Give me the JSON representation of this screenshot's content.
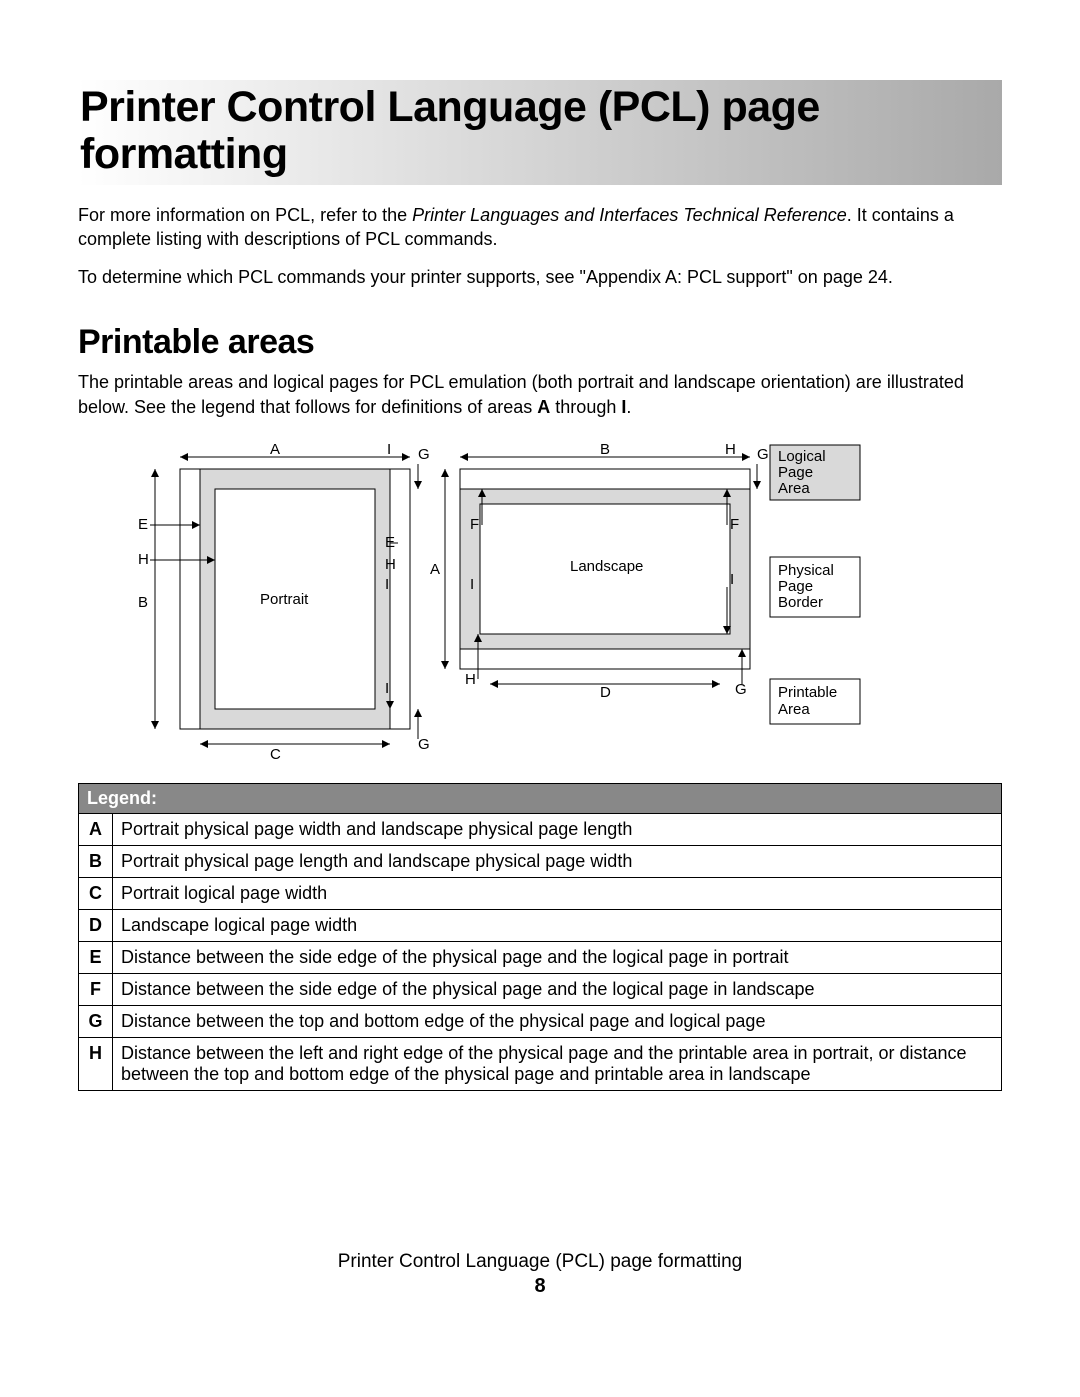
{
  "title": "Printer Control Language (PCL) page formatting",
  "intro1_a": "For more information on PCL, refer to the ",
  "intro1_em": "Printer Languages and Interfaces Technical Reference",
  "intro1_b": ". It contains a complete listing with descriptions of PCL commands.",
  "intro2": "To determine which PCL commands your printer supports, see \"Appendix A: PCL support\" on page 24.",
  "section_heading": "Printable areas",
  "section_para_a": "The printable areas and logical pages for PCL emulation (both portrait and landscape orientation) are illustrated below. See the legend that follows for definitions of areas ",
  "section_para_b1": "A",
  "section_para_mid": " through ",
  "section_para_b2": "I",
  "section_para_end": ".",
  "diagram": {
    "portrait_label": "Portrait",
    "landscape_label": "Landscape",
    "logical_page_area": "Logical Page Area",
    "physical_page_border": "Physical Page Border",
    "printable_area": "Printable Area",
    "A": "A",
    "B": "B",
    "C": "C",
    "D": "D",
    "E": "E",
    "F": "F",
    "G": "G",
    "H": "H",
    "I": "I"
  },
  "legend": {
    "header": "Legend:",
    "rows": [
      {
        "key": "A",
        "desc": "Portrait physical page width and landscape physical page length"
      },
      {
        "key": "B",
        "desc": "Portrait physical page length and landscape physical page width"
      },
      {
        "key": "C",
        "desc": "Portrait logical page width"
      },
      {
        "key": "D",
        "desc": "Landscape logical page width"
      },
      {
        "key": "E",
        "desc": "Distance between the side edge of the physical page and the logical page in portrait"
      },
      {
        "key": "F",
        "desc": "Distance between the side edge of the physical page and the logical page in landscape"
      },
      {
        "key": "G",
        "desc": "Distance between the top and bottom edge of the physical page and logical page"
      },
      {
        "key": "H",
        "desc": "Distance between the left and right edge of the physical page and the printable area in portrait, or distance between the top and bottom edge of the physical page and printable area in landscape"
      }
    ]
  },
  "footer_title": "Printer Control Language (PCL) page formatting",
  "page_number": "8"
}
